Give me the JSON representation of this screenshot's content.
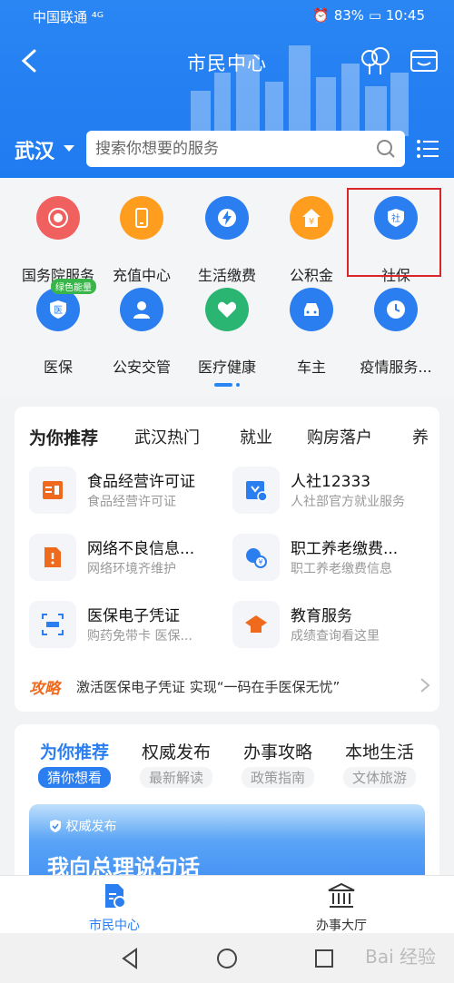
{
  "status_bar": {
    "left": "中国联通 ⁴ᴳ",
    "right": "⏰ 83% ▭ 10:45"
  },
  "header": {
    "title": "市民中心"
  },
  "search": {
    "city": "武汉",
    "placeholder": "搜索你想要的服务"
  },
  "grid": {
    "items": [
      {
        "label": "国务院服务",
        "color": "#f0605f"
      },
      {
        "label": "充值中心",
        "color": "#ff9d1e"
      },
      {
        "label": "生活缴费",
        "color": "#2a7ef0"
      },
      {
        "label": "公积金",
        "color": "#ff9d1e"
      },
      {
        "label": "社保",
        "color": "#2a7ef0"
      },
      {
        "label": "医保",
        "color": "#2a7ef0"
      },
      {
        "label": "公安交管",
        "color": "#2a7ef0"
      },
      {
        "label": "医疗健康",
        "color": "#2bb573"
      },
      {
        "label": "车主",
        "color": "#2a7ef0"
      },
      {
        "label": "疫情服务...",
        "color": "#2a7ef0"
      }
    ],
    "badge": "绿色能量",
    "icon_text_shebao": "社",
    "icon_text_yibao": "医",
    "icon_text_gjj": "¥"
  },
  "recommend": {
    "tabs": [
      "为你推荐",
      "武汉热门",
      "就业",
      "购房落户",
      "养"
    ],
    "services": [
      {
        "title": "食品经营许可证",
        "sub": "食品经营许可证"
      },
      {
        "title": "人社12333",
        "sub": "人社部官方就业服务"
      },
      {
        "title": "网络不良信息...",
        "sub": "网络环境齐维护"
      },
      {
        "title": "职工养老缴费...",
        "sub": "职工养老缴费信息"
      },
      {
        "title": "医保电子凭证",
        "sub": "购药免带卡 医保..."
      },
      {
        "title": "教育服务",
        "sub": "成绩查询看这里"
      }
    ],
    "strategy_tag": "攻略",
    "strategy_text": "激活医保电子凭证 实现“一码在手医保无忧”"
  },
  "news": {
    "tabs": [
      {
        "title": "为你推荐",
        "sub": "猜你想看"
      },
      {
        "title": "权威发布",
        "sub": "最新解读"
      },
      {
        "title": "办事攻略",
        "sub": "政策指南"
      },
      {
        "title": "本地生活",
        "sub": "文体旅游"
      }
    ],
    "banner_tag": "权威发布",
    "banner_title": "我向总理说句话"
  },
  "bottom_nav": {
    "items": [
      "市民中心",
      "办事大厅"
    ]
  },
  "watermark": "Bai 经验"
}
